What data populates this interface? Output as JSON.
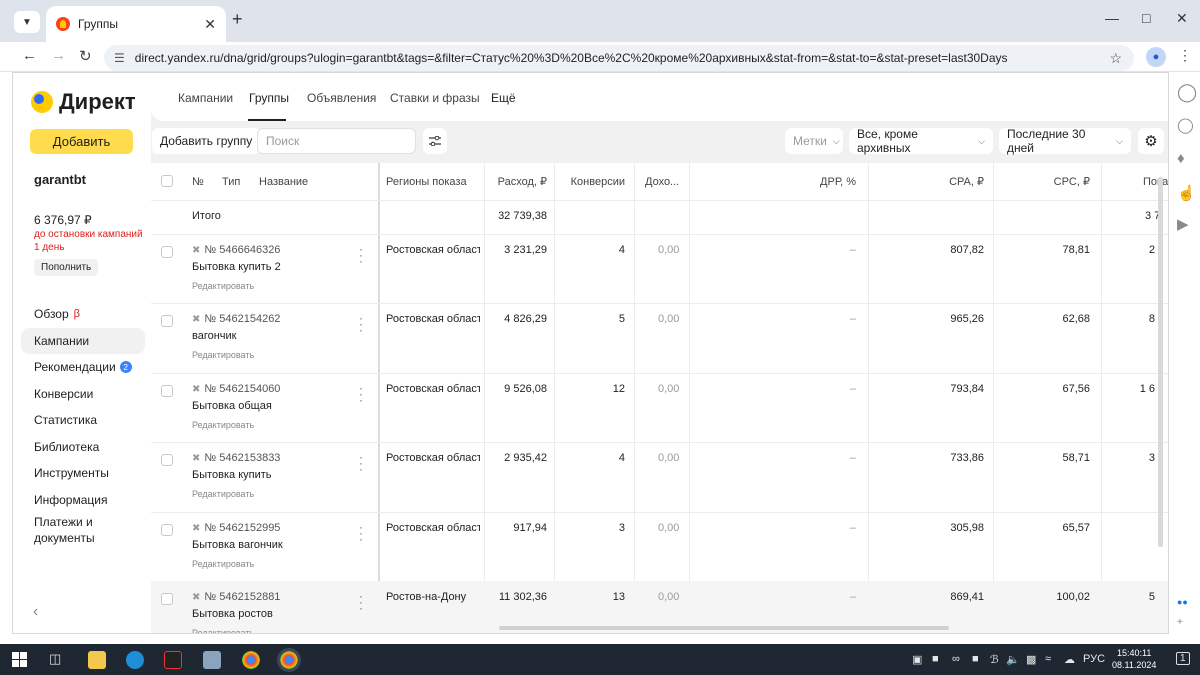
{
  "browser": {
    "tab_title": "Группы",
    "url": "direct.yandex.ru/dna/grid/groups?ulogin=garantbt&tags=&filter=Статус%20%3D%20Все%2C%20кроме%20архивных&stat-from=&stat-to=&stat-preset=last30Days",
    "icons": [
      "tab-dropdown-icon",
      "yandex-favicon",
      "close-icon",
      "plus-icon",
      "minimize-icon",
      "maximize-icon",
      "close-window-icon",
      "back-arrow-icon",
      "forward-arrow-icon",
      "reload-icon",
      "site-settings-icon",
      "bookmark-star-icon",
      "profile-icon",
      "browser-menu-icon"
    ]
  },
  "sidebar": {
    "logo": "Директ",
    "add_button": "Добавить",
    "login": "garantbt",
    "balance": "6 376,97 ₽",
    "balance_warning": "до остановки кампаний 1 день",
    "topup_button": "Пополнить",
    "nav": [
      {
        "label": "Обзор",
        "beta": "β"
      },
      {
        "label": "Кампании"
      },
      {
        "label": "Рекомендации",
        "badge": "2"
      },
      {
        "label": "Конверсии"
      },
      {
        "label": "Статистика"
      },
      {
        "label": "Библиотека"
      },
      {
        "label": "Инструменты"
      },
      {
        "label": "Информация"
      },
      {
        "label": "Платежи и документы"
      }
    ],
    "collapse_icon": "chevron-left-icon"
  },
  "topnav": {
    "items": [
      "Кампании",
      "Группы",
      "Объявления",
      "Ставки и фразы",
      "Ещё"
    ],
    "active": "Группы"
  },
  "toolbar": {
    "add_group": "Добавить группу",
    "search_placeholder": "Поиск",
    "filter_icon": "sliders-icon",
    "tags": "Метки",
    "status_filter": "Все, кроме архивных",
    "period": "Последние 30 дней",
    "settings_icon": "gear-icon"
  },
  "grid": {
    "headers": {
      "no": "№",
      "type": "Тип",
      "name": "Название",
      "regions": "Регионы показа",
      "spend": "Расход, ₽",
      "conversions": "Конверсии",
      "revenue": "Дохо...",
      "drr": "ДРР, %",
      "cpa": "CPA, ₽",
      "cpc": "CPC, ₽",
      "impressions": "Пока"
    },
    "total": {
      "label": "Итого",
      "spend": "32 739,38",
      "impressions": "3 7"
    },
    "edit_label": "Редактировать",
    "rows": [
      {
        "id": "№ 5466646326",
        "name": "Бытовка купить 2",
        "region": "Ростовская област",
        "spend": "3 231,29",
        "conversions": "4",
        "revenue": "0,00",
        "drr": "–",
        "cpa": "807,82",
        "cpc": "78,81",
        "impressions": "2"
      },
      {
        "id": "№ 5462154262",
        "name": "вагончик",
        "region": "Ростовская област",
        "spend": "4 826,29",
        "conversions": "5",
        "revenue": "0,00",
        "drr": "–",
        "cpa": "965,26",
        "cpc": "62,68",
        "impressions": "8"
      },
      {
        "id": "№ 5462154060",
        "name": "Бытовка общая",
        "region": "Ростовская област",
        "spend": "9 526,08",
        "conversions": "12",
        "revenue": "0,00",
        "drr": "–",
        "cpa": "793,84",
        "cpc": "67,56",
        "impressions": "1 6"
      },
      {
        "id": "№ 5462153833",
        "name": "Бытовка купить",
        "region": "Ростовская област",
        "spend": "2 935,42",
        "conversions": "4",
        "revenue": "0,00",
        "drr": "–",
        "cpa": "733,86",
        "cpc": "58,71",
        "impressions": "3"
      },
      {
        "id": "№ 5462152995",
        "name": "Бытовка вагончик",
        "region": "Ростовская област",
        "spend": "917,94",
        "conversions": "3",
        "revenue": "0,00",
        "drr": "–",
        "cpa": "305,98",
        "cpc": "65,57",
        "impressions": ""
      },
      {
        "id": "№ 5462152881",
        "name": "Бытовка ростов",
        "region": "Ростов-на-Дону",
        "spend": "11 302,36",
        "conversions": "13",
        "revenue": "0,00",
        "drr": "–",
        "cpa": "869,41",
        "cpc": "100,02",
        "impressions": "5"
      }
    ]
  },
  "taskbar": {
    "language": "РУС",
    "time": "15:40:11",
    "date": "08.11.2024",
    "notifications": "1"
  },
  "colors": {
    "accent_yellow": "#ffdb4d",
    "warning_red": "#e0201b",
    "badge_blue": "#3f83f8"
  }
}
